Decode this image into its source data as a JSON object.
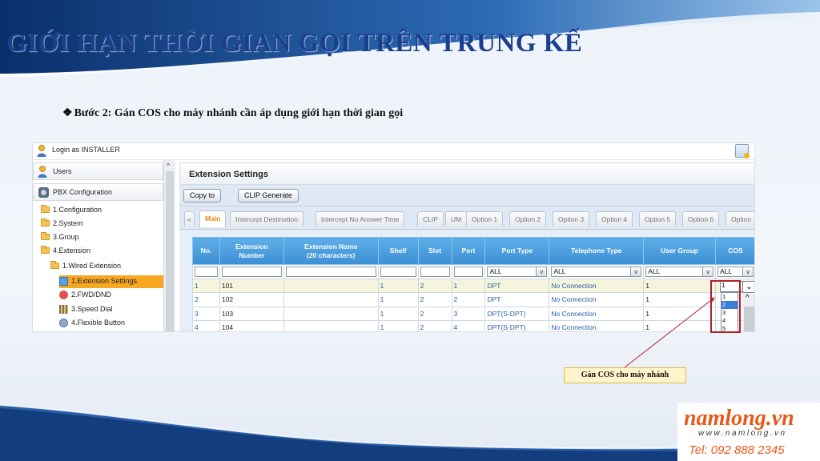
{
  "slide": {
    "title": "GIỚI HẠN THỜI GIAN GỌI TRÊN TRUNG KẾ",
    "step_bullet": "❖",
    "step": "Bước 2: Gán COS cho máy nhánh cần áp dụng giới hạn thời gian gọi",
    "callout": "Gán COS cho máy nhánh",
    "colors": {
      "title": "#1b3f8f",
      "frame": "#b0202a",
      "accent": "#f7a823",
      "header": "#3b8fd4"
    }
  },
  "topbar": {
    "login": "Login as INSTALLER",
    "icons": [
      "user-icon",
      "help-icon"
    ]
  },
  "sidebar": {
    "users": "Users",
    "pbx": "PBX Configuration",
    "tree": {
      "configuration": "1.Configuration",
      "system": "2.System",
      "group": "3.Group",
      "extension": "4.Extension",
      "wired": "1.Wired Extension",
      "ext_settings": "1.Extension Settings",
      "fwd": "2.FWD/DND",
      "speed": "3.Speed Dial",
      "flex": "4.Flexible Button"
    }
  },
  "main": {
    "title": "Extension Settings",
    "buttons": {
      "copy": "Copy to",
      "clip": "CLIP Generate"
    },
    "tabs": {
      "prev": "«",
      "main": "Main",
      "intercept_dest": "Intercept Destination",
      "intercept_no_ans": "Intercept No Answer Time",
      "clip": "CLIP",
      "um": "UM",
      "opt1": "Option 1",
      "opt2": "Option 2",
      "opt3": "Option 3",
      "opt4": "Option 4",
      "opt5": "Option 5",
      "opt6": "Option 6",
      "opt7": "Option"
    }
  },
  "table": {
    "headers": {
      "no": "No.",
      "ext_num_1": "Extension",
      "ext_num_2": "Number",
      "ext_name_1": "Extension Name",
      "ext_name_2": "(20 characters)",
      "shelf": "Shelf",
      "slot": "Slot",
      "port": "Port",
      "port_type": "Port Type",
      "tel_type": "Telephone Type",
      "user_group": "User Group",
      "cos": "COS"
    },
    "filters": {
      "port_type": "ALL",
      "tel_type": "ALL",
      "user_group": "ALL",
      "cos": "ALL"
    },
    "rows": [
      {
        "no": "1",
        "ext": "101",
        "name": "",
        "shelf": "1",
        "slot": "2",
        "port": "1",
        "port_type": "DPT",
        "tel_type": "No Connection",
        "user_group": "1"
      },
      {
        "no": "2",
        "ext": "102",
        "name": "",
        "shelf": "1",
        "slot": "2",
        "port": "2",
        "port_type": "DPT",
        "tel_type": "No Connection",
        "user_group": "1"
      },
      {
        "no": "3",
        "ext": "103",
        "name": "",
        "shelf": "1",
        "slot": "2",
        "port": "3",
        "port_type": "DPT(S-DPT)",
        "tel_type": "No Connection",
        "user_group": "1"
      },
      {
        "no": "4",
        "ext": "104",
        "name": "",
        "shelf": "1",
        "slot": "2",
        "port": "4",
        "port_type": "DPT(S-DPT)",
        "tel_type": "No Connection",
        "user_group": "1"
      }
    ],
    "cos_dropdown": {
      "current": "1",
      "options": [
        "1",
        "2",
        "3",
        "4",
        "5"
      ],
      "highlighted": "2"
    }
  },
  "logo": {
    "brand": "namlong.vn",
    "web": "www.namlong.vn",
    "tel": "Tel: 092 888 2345"
  }
}
